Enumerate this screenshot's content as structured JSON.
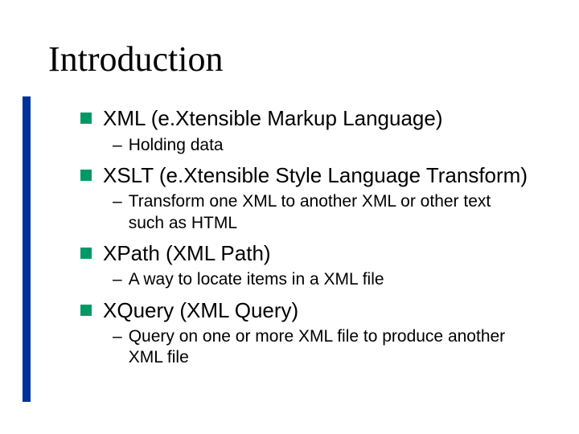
{
  "slide": {
    "title": "Introduction",
    "bullets": [
      {
        "label": "XML (e.Xtensible Markup Language)",
        "subs": [
          "Holding data"
        ]
      },
      {
        "label": "XSLT (e.Xtensible Style Language Transform)",
        "subs": [
          "Transform one XML to another XML or other text such as HTML"
        ]
      },
      {
        "label": "XPath (XML Path)",
        "subs": [
          "A way to locate items in a XML file"
        ]
      },
      {
        "label": "XQuery (XML Query)",
        "subs": [
          "Query on one or more XML file to produce another XML file"
        ]
      }
    ]
  },
  "dash": "–"
}
